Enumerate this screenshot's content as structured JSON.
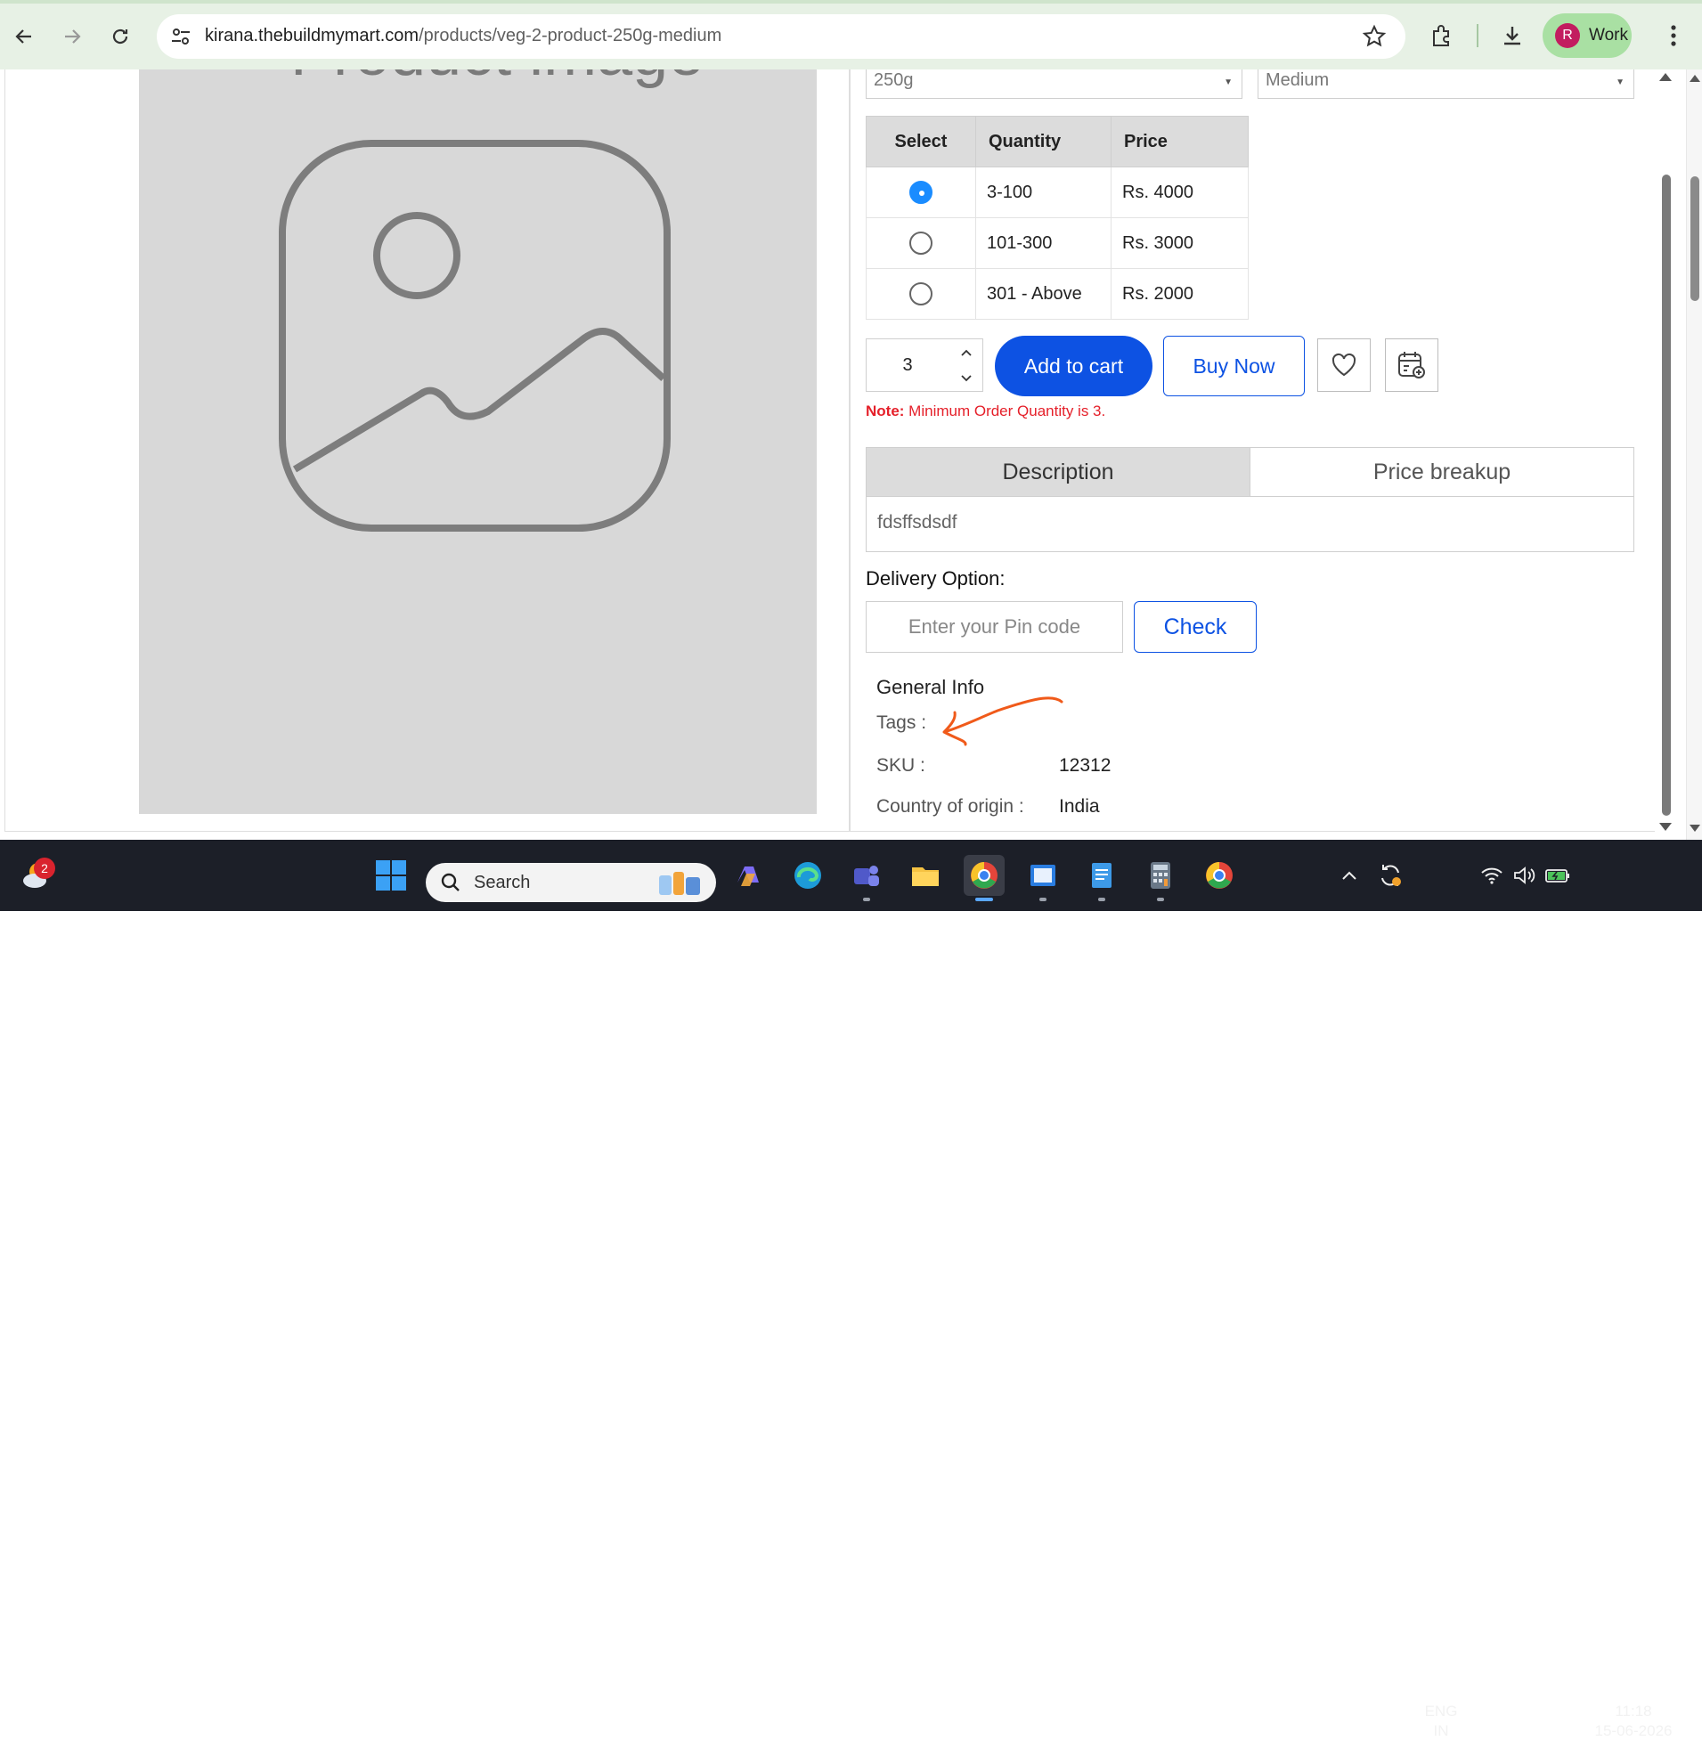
{
  "browser": {
    "url_host": "kirana.thebuildmymart.com",
    "url_path": "/products/veg-2-product-250g-medium",
    "profile_initial": "R",
    "profile_name": "Work"
  },
  "product": {
    "image_placeholder_text": "Product image",
    "selects": [
      {
        "value": "250g"
      },
      {
        "value": "Medium"
      }
    ],
    "tier_table": {
      "headers": [
        "Select",
        "Quantity",
        "Price"
      ],
      "rows": [
        {
          "quantity": "3-100",
          "price": "Rs. 4000",
          "selected": true
        },
        {
          "quantity": "101-300",
          "price": "Rs. 3000",
          "selected": false
        },
        {
          "quantity": "301 - Above",
          "price": "Rs. 2000",
          "selected": false
        }
      ]
    },
    "quantity": "3",
    "add_to_cart_label": "Add to cart",
    "buy_now_label": "Buy Now",
    "note_label": "Note:",
    "note_text": " Minimum Order Quantity is 3.",
    "tabs": [
      "Description",
      "Price breakup"
    ],
    "description_text": "fdsffsdsdf",
    "delivery_label": "Delivery Option:",
    "pin_placeholder": "Enter your Pin code",
    "check_label": "Check",
    "general_info_title": "General Info",
    "info": [
      {
        "label": "Tags :",
        "value": ""
      },
      {
        "label": "SKU :",
        "value": "12312"
      },
      {
        "label": "Country of origin :",
        "value": "India"
      }
    ]
  },
  "taskbar": {
    "weather_badge": "2",
    "search_label": "Search",
    "lang_top": "ENG",
    "lang_bottom": "IN",
    "time": "11:18",
    "date": "15-06-2026"
  },
  "colors": {
    "primary": "#0d52e3",
    "note_red": "#e5202a",
    "radio_blue": "#1a8cff",
    "annotation_orange": "#f05a1a"
  }
}
